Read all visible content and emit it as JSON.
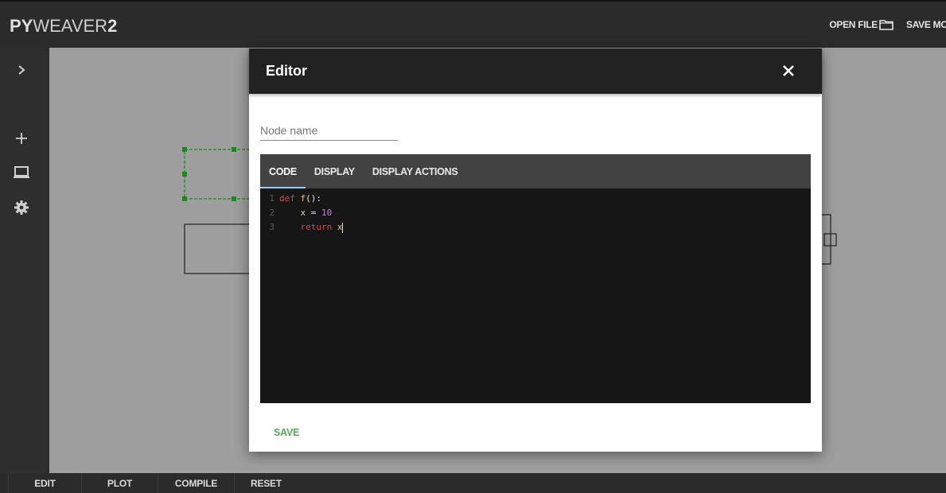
{
  "app": {
    "brand_bold": "PY",
    "brand_mid": "WEAVER",
    "brand_num": "2",
    "open_file_label": "OPEN FILE",
    "save_label": "SAVE MO"
  },
  "bottom_tabs": [
    "EDIT",
    "PLOT",
    "COMPILE",
    "RESET"
  ],
  "rail": {
    "icons": [
      "chevron-right-icon",
      "plus-icon",
      "laptop-icon",
      "gear-icon"
    ]
  },
  "modal": {
    "title": "Editor",
    "node_name_placeholder": "Node name",
    "node_name_value": "",
    "tabs": [
      "CODE",
      "DISPLAY",
      "DISPLAY ACTIONS"
    ],
    "active_tab": "CODE",
    "code_lines": [
      {
        "num": "1",
        "tokens": [
          {
            "t": "def ",
            "c": "kw"
          },
          {
            "t": "f",
            "c": "fn"
          },
          {
            "t": "():",
            "c": "pn"
          }
        ]
      },
      {
        "num": "2",
        "tokens": [
          {
            "t": "    ",
            "c": "pn"
          },
          {
            "t": "x",
            "c": "var"
          },
          {
            "t": " = ",
            "c": "op"
          },
          {
            "t": "10",
            "c": "num"
          }
        ]
      },
      {
        "num": "3",
        "tokens": [
          {
            "t": "    ",
            "c": "pn"
          },
          {
            "t": "return ",
            "c": "kw"
          },
          {
            "t": "x",
            "c": "var"
          }
        ]
      }
    ],
    "save_label": "SAVE"
  },
  "colors": {
    "topbar": "#2b2b2b",
    "canvas": "#9e9e9e",
    "modal_header": "#222222",
    "editor_bg": "#161616",
    "tab_indicator": "#90caf9",
    "save_green": "#4caf50",
    "selection_green": "#1a8a1a"
  }
}
